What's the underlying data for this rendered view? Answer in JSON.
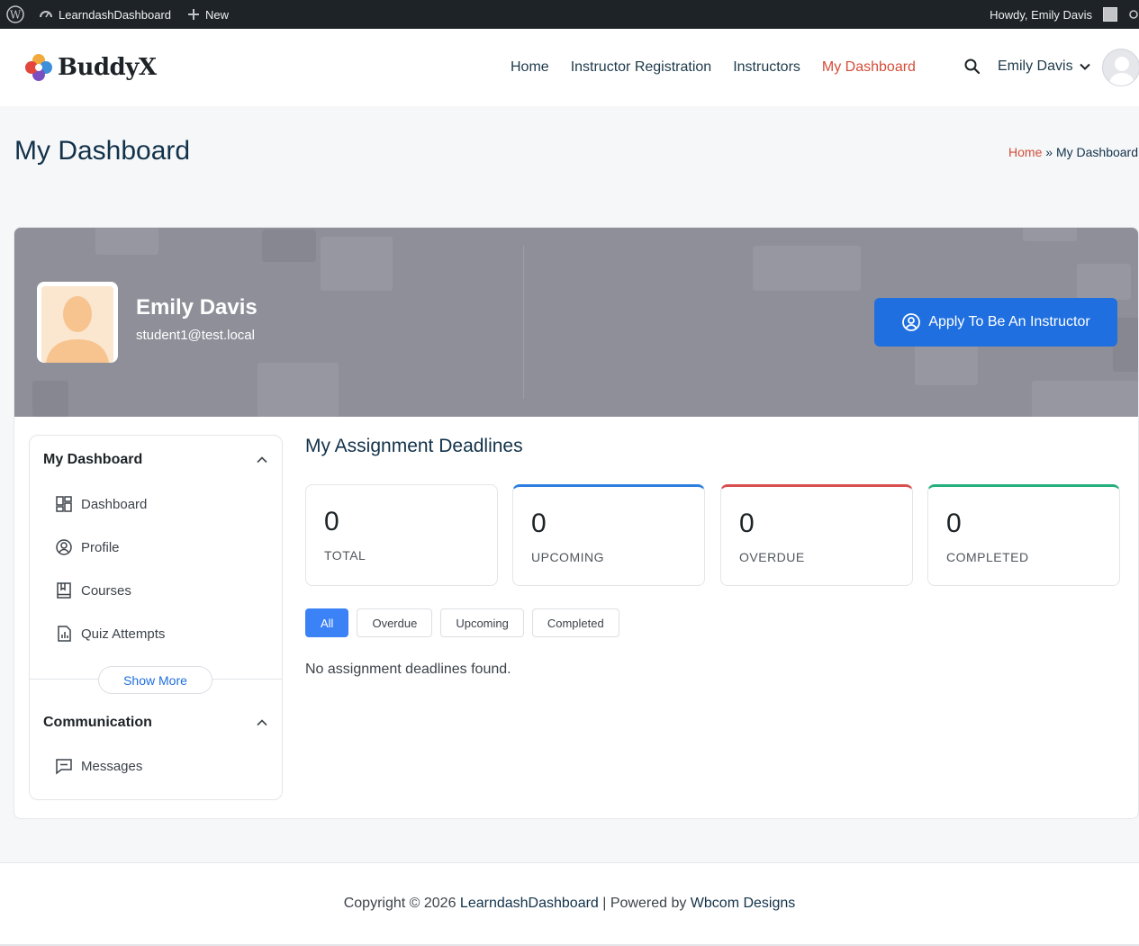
{
  "adminbar": {
    "site_name": "LearndashDashboard",
    "new_label": "New",
    "howdy": "Howdy, Emily Davis"
  },
  "header": {
    "logo_text": "BuddyX",
    "nav": [
      {
        "label": "Home"
      },
      {
        "label": "Instructor Registration"
      },
      {
        "label": "Instructors"
      },
      {
        "label": "My Dashboard",
        "active": true
      }
    ],
    "user_name": "Emily Davis"
  },
  "title_band": {
    "title": "My Dashboard",
    "breadcrumb_home": "Home",
    "breadcrumb_sep": "»",
    "breadcrumb_current": "My Dashboard"
  },
  "profile": {
    "name": "Emily Davis",
    "email": "student1@test.local",
    "apply_label": "Apply To Be An Instructor"
  },
  "sidebar": {
    "section1_title": "My Dashboard",
    "items": [
      {
        "label": "Dashboard",
        "icon": "dashboard-icon"
      },
      {
        "label": "Profile",
        "icon": "user-circle-icon"
      },
      {
        "label": "Courses",
        "icon": "book-icon"
      },
      {
        "label": "Quiz Attempts",
        "icon": "chart-file-icon"
      }
    ],
    "show_more": "Show More",
    "section2_title": "Communication",
    "comm_items": [
      {
        "label": "Messages",
        "icon": "message-icon"
      }
    ]
  },
  "deadlines": {
    "title": "My Assignment Deadlines",
    "stats": [
      {
        "value": "0",
        "label": "TOTAL"
      },
      {
        "value": "0",
        "label": "UPCOMING",
        "color": "#2f7fe0"
      },
      {
        "value": "0",
        "label": "OVERDUE",
        "color": "#d94f4f"
      },
      {
        "value": "0",
        "label": "COMPLETED",
        "color": "#26b07d"
      }
    ],
    "filters": [
      {
        "label": "All",
        "active": true
      },
      {
        "label": "Overdue"
      },
      {
        "label": "Upcoming"
      },
      {
        "label": "Completed"
      }
    ],
    "empty_message": "No assignment deadlines found."
  },
  "footer": {
    "prefix": "Copyright © 2026 ",
    "site_link": "LearndashDashboard",
    "middle": " | Powered by ",
    "powered_link": "Wbcom Designs"
  },
  "colors": {
    "accent": "#d34d38",
    "primary": "#1f6fe0",
    "heading": "#12324a"
  }
}
